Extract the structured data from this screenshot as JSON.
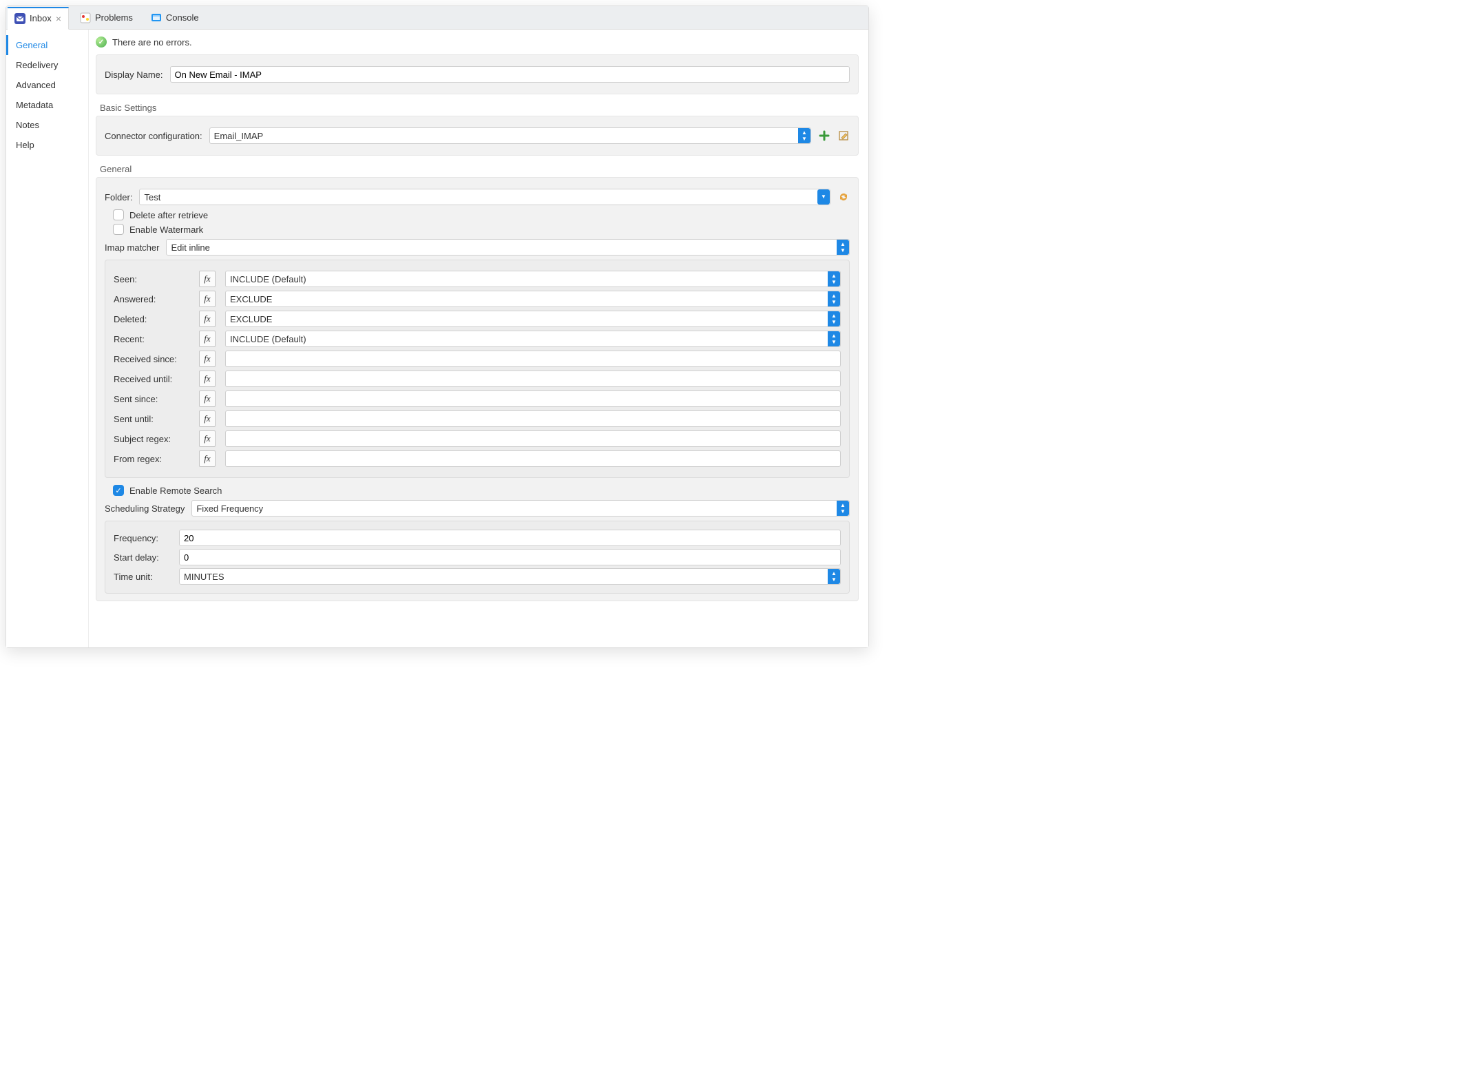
{
  "tabs": {
    "inbox": "Inbox",
    "problems": "Problems",
    "console": "Console"
  },
  "sidenav": {
    "general": "General",
    "redelivery": "Redelivery",
    "advanced": "Advanced",
    "metadata": "Metadata",
    "notes": "Notes",
    "help": "Help"
  },
  "status_text": "There are no errors.",
  "display_name": {
    "label": "Display Name:",
    "value": "On New Email - IMAP"
  },
  "basic_settings": {
    "title": "Basic Settings",
    "connector_label": "Connector configuration:",
    "connector_value": "Email_IMAP"
  },
  "general_section": {
    "title": "General",
    "folder_label": "Folder:",
    "folder_value": "Test",
    "delete_after_label": "Delete after retrieve",
    "enable_watermark_label": "Enable Watermark",
    "imap_matcher_label": "Imap matcher",
    "imap_matcher_value": "Edit inline",
    "matcher": {
      "seen": {
        "label": "Seen:",
        "value": "INCLUDE (Default)"
      },
      "answered": {
        "label": "Answered:",
        "value": "EXCLUDE"
      },
      "deleted": {
        "label": "Deleted:",
        "value": "EXCLUDE"
      },
      "recent": {
        "label": "Recent:",
        "value": "INCLUDE (Default)"
      },
      "received_since": {
        "label": "Received since:",
        "value": ""
      },
      "received_until": {
        "label": "Received until:",
        "value": ""
      },
      "sent_since": {
        "label": "Sent since:",
        "value": ""
      },
      "sent_until": {
        "label": "Sent until:",
        "value": ""
      },
      "subject_regex": {
        "label": "Subject regex:",
        "value": ""
      },
      "from_regex": {
        "label": "From regex:",
        "value": ""
      }
    },
    "enable_remote_search_label": "Enable Remote Search",
    "scheduling_label": "Scheduling Strategy",
    "scheduling_value": "Fixed Frequency",
    "frequency_label": "Frequency:",
    "frequency_value": "20",
    "start_delay_label": "Start delay:",
    "start_delay_value": "0",
    "time_unit_label": "Time unit:",
    "time_unit_value": "MINUTES"
  },
  "icons": {
    "fx": "fx",
    "close": "×",
    "check": "✓"
  }
}
